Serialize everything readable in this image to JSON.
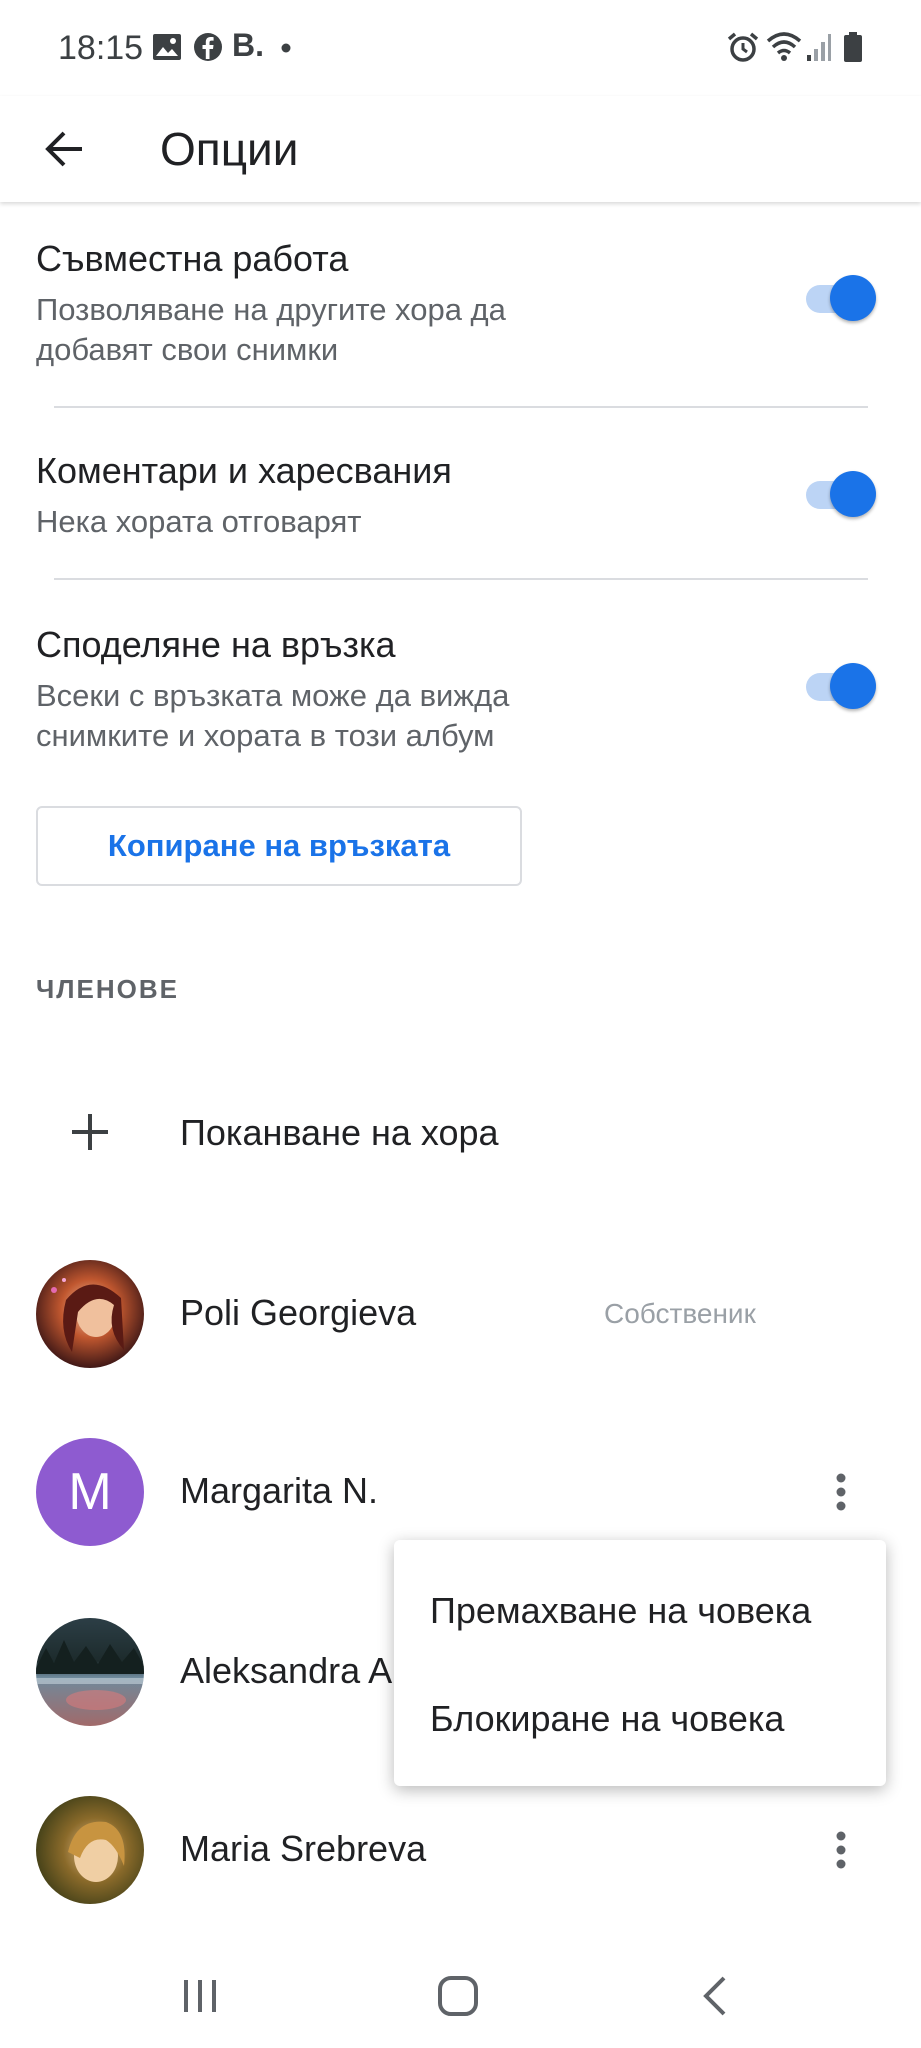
{
  "status_bar": {
    "time": "18:15",
    "left_icons": [
      "image-icon",
      "facebook-icon",
      "b-letter-icon",
      "dot-icon"
    ],
    "b_letter": "B.",
    "right_icons": [
      "alarm-icon",
      "wifi-icon",
      "signal-icon",
      "battery-icon"
    ]
  },
  "app_bar": {
    "title": "Опции",
    "back_icon": "arrow-back-icon"
  },
  "settings": {
    "collaboration": {
      "title": "Съвместна работа",
      "subtitle": "Позволяване на другите хора да добавят свои снимки",
      "enabled": true
    },
    "comments": {
      "title": "Коментари и харесвания",
      "subtitle": "Нека хората отговарят",
      "enabled": true
    },
    "link_sharing": {
      "title": "Споделяне на връзка",
      "subtitle": "Всеки с връзката може да вижда снимките и хората в този албум",
      "enabled": true
    },
    "copy_link_label": "Копиране на връзката"
  },
  "members": {
    "header": "ЧЛЕНОВЕ",
    "invite_label": "Поканване на хора",
    "list": [
      {
        "name": "Poli Georgieva",
        "role": "Собственик"
      },
      {
        "name": "Margarita N.",
        "avatar_letter": "M"
      },
      {
        "name": "Aleksandra A"
      },
      {
        "name": "Maria Srebreva"
      }
    ]
  },
  "popup_menu": {
    "items": [
      "Премахване на човека",
      "Блокиране на човека"
    ]
  },
  "nav_bar": {
    "icons": [
      "recents-icon",
      "home-icon",
      "back-nav-icon"
    ]
  },
  "colors": {
    "accent": "#1a73e8",
    "toggle_track": "#bcd4f5",
    "avatar_purple": "#8e5bd0",
    "secondary_text": "#5f6368"
  }
}
